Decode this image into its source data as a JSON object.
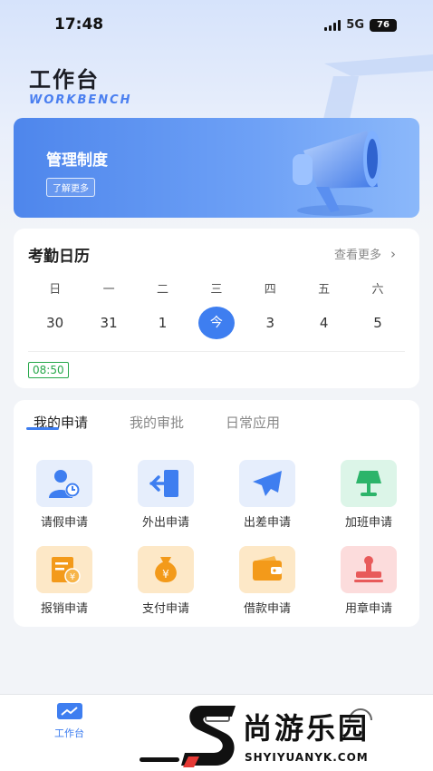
{
  "status": {
    "time": "17:48",
    "network": "5G",
    "battery": "76"
  },
  "header": {
    "title": "工作台",
    "subtitle": "WORKBENCH"
  },
  "banner": {
    "title": "管理制度",
    "button": "了解更多"
  },
  "calendar": {
    "title": "考勤日历",
    "more": "查看更多",
    "weekdays": [
      "日",
      "一",
      "二",
      "三",
      "四",
      "五",
      "六"
    ],
    "dates": [
      "30",
      "31",
      "1",
      "今",
      "3",
      "4",
      "5"
    ],
    "time": "08:50"
  },
  "apps": {
    "tabs": [
      "我的申请",
      "我的审批",
      "日常应用"
    ],
    "items": [
      {
        "label": "请假申请",
        "icon": "person-clock-icon",
        "bg": "#e6eefc"
      },
      {
        "label": "外出申请",
        "icon": "door-exit-icon",
        "bg": "#e6eefc"
      },
      {
        "label": "出差申请",
        "icon": "airplane-icon",
        "bg": "#e6eefc"
      },
      {
        "label": "加班申请",
        "icon": "lamp-icon",
        "bg": "#dcf5e8"
      },
      {
        "label": "报销申请",
        "icon": "receipt-yen-icon",
        "bg": "#fde8c7"
      },
      {
        "label": "支付申请",
        "icon": "money-bag-icon",
        "bg": "#fde8c7"
      },
      {
        "label": "借款申请",
        "icon": "wallet-icon",
        "bg": "#fde8c7"
      },
      {
        "label": "用章申请",
        "icon": "stamp-icon",
        "bg": "#fcdcdc"
      }
    ]
  },
  "nav": {
    "workbench": "工作台"
  },
  "watermark": {
    "name": "尚游乐园",
    "url": "SHYIYUANYK.COM"
  },
  "colors": {
    "accent": "#3e7ef0",
    "green": "#27a84a"
  }
}
